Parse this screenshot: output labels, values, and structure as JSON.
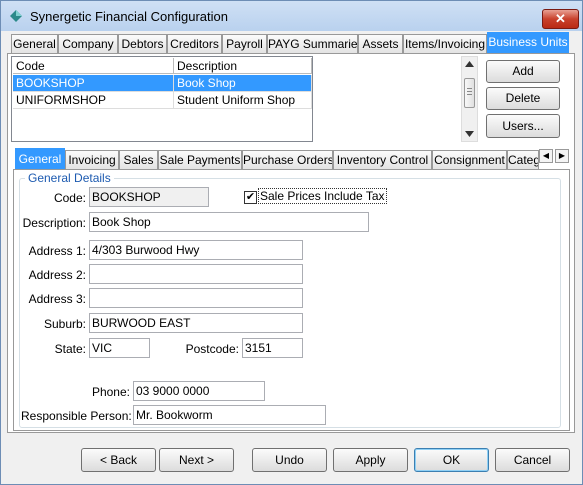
{
  "window": {
    "title": "Synergetic Financial Configuration",
    "close_label": "✕"
  },
  "top_tabs": [
    "General",
    "Company",
    "Debtors",
    "Creditors",
    "Payroll",
    "PAYG Summaries",
    "Assets",
    "Items/Invoicing",
    "Business Units"
  ],
  "grid": {
    "headers": [
      "Code",
      "Description"
    ],
    "rows": [
      {
        "code": "BOOKSHOP",
        "description": "Book Shop"
      },
      {
        "code": "UNIFORMSHOP",
        "description": "Student Uniform Shop"
      }
    ]
  },
  "side_buttons": {
    "add": "Add",
    "delete": "Delete",
    "users": "Users..."
  },
  "sub_tabs": [
    "General",
    "Invoicing",
    "Sales",
    "Sale Payments",
    "Purchase Orders",
    "Inventory Control",
    "Consignment",
    "Categ"
  ],
  "form": {
    "group_label": "General Details",
    "code_label": "Code:",
    "code_value": "BOOKSHOP",
    "sale_prices_label": "Sale Prices Include Tax",
    "sale_prices_checked": "✔",
    "description_label": "Description:",
    "description_value": "Book Shop",
    "address1_label": "Address 1:",
    "address1_value": "4/303 Burwood Hwy",
    "address2_label": "Address 2:",
    "address2_value": "",
    "address3_label": "Address 3:",
    "address3_value": "",
    "suburb_label": "Suburb:",
    "suburb_value": "BURWOOD EAST",
    "state_label": "State:",
    "state_value": "VIC",
    "postcode_label": "Postcode:",
    "postcode_value": "3151",
    "phone_label": "Phone:",
    "phone_value": "03 9000 0000",
    "responsible_label": "Responsible Person:",
    "responsible_value": "Mr. Bookworm"
  },
  "bottom_buttons": {
    "back": "< Back",
    "next": "Next >",
    "undo": "Undo",
    "apply": "Apply",
    "ok": "OK",
    "cancel": "Cancel"
  }
}
